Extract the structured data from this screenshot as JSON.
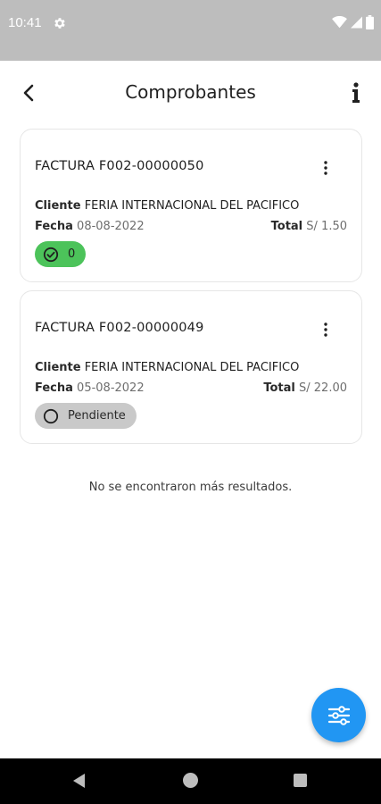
{
  "status_bar": {
    "time": "10:41"
  },
  "header": {
    "title": "Comprobantes"
  },
  "invoices": [
    {
      "title": "FACTURA F002-00000050",
      "client_label": "Cliente",
      "client_name": "FERIA INTERNACIONAL DEL PACIFICO",
      "date_label": "Fecha",
      "date": "08-08-2022",
      "total_label": "Total",
      "total": "S/ 1.50",
      "status": "0",
      "status_color": "#4cc35a"
    },
    {
      "title": "FACTURA F002-00000049",
      "client_label": "Cliente",
      "client_name": "FERIA INTERNACIONAL DEL PACIFICO",
      "date_label": "Fecha",
      "date": "05-08-2022",
      "total_label": "Total",
      "total": "S/ 22.00",
      "status": "Pendiente",
      "status_color": "#c9c9c9"
    }
  ],
  "empty_message": "No se encontraron más resultados.",
  "colors": {
    "accent": "#2196f3",
    "success": "#4cc35a"
  },
  "icons": [
    "settings-icon",
    "wifi-icon",
    "signal-icon",
    "battery-icon",
    "back-arrow-icon",
    "info-icon",
    "more-vert-icon",
    "check-circle-icon",
    "empty-circle-icon",
    "filter-sliders-icon",
    "nav-back-icon",
    "nav-home-icon",
    "nav-recents-icon"
  ]
}
